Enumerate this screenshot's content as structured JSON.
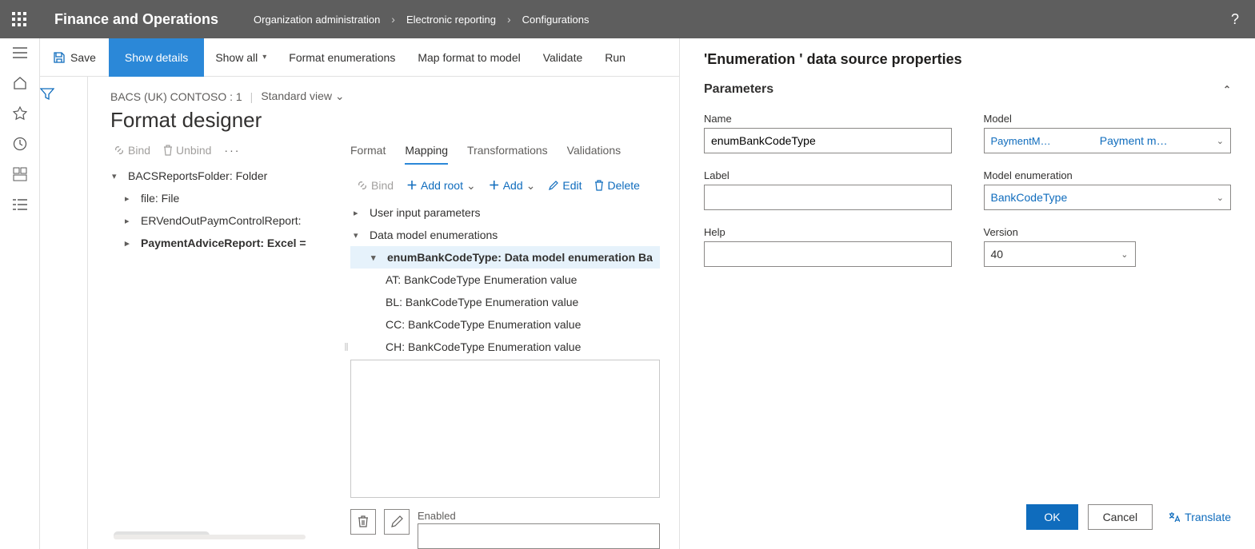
{
  "app_title": "Finance and Operations",
  "breadcrumb": [
    "Organization administration",
    "Electronic reporting",
    "Configurations"
  ],
  "cmdbar": {
    "save": "Save",
    "show_details": "Show details",
    "show_all": "Show all",
    "format_enum": "Format enumerations",
    "map_format": "Map format to model",
    "validate": "Validate",
    "run": "Run"
  },
  "designer": {
    "entity": "BACS (UK) CONTOSO : 1",
    "view": "Standard view",
    "title": "Format designer",
    "left_actions": {
      "bind": "Bind",
      "unbind": "Unbind"
    },
    "left_tree": [
      {
        "label": "BACSReportsFolder: Folder",
        "caret": "▾",
        "lvl": 0
      },
      {
        "label": "file: File",
        "caret": "▸",
        "lvl": 1
      },
      {
        "label": "ERVendOutPaymControlReport:",
        "caret": "▸",
        "lvl": 1
      },
      {
        "label": "PaymentAdviceReport: Excel =",
        "caret": "▸",
        "lvl": 1,
        "bold": true
      }
    ],
    "tabs": [
      "Format",
      "Mapping",
      "Transformations",
      "Validations"
    ],
    "active_tab": "Mapping",
    "right_actions": {
      "bind": "Bind",
      "add_root": "Add root",
      "add": "Add",
      "edit": "Edit",
      "delete": "Delete"
    },
    "map_tree": [
      {
        "label": "User input parameters",
        "caret": "▸",
        "lvl": 0
      },
      {
        "label": "Data model enumerations",
        "caret": "▾",
        "lvl": 0
      },
      {
        "label": "enumBankCodeType: Data model enumeration Ba",
        "caret": "▾",
        "lvl": 1,
        "sel": true
      },
      {
        "label": "AT: BankCodeType Enumeration value",
        "lvl": 2
      },
      {
        "label": "BL: BankCodeType Enumeration value",
        "lvl": 2
      },
      {
        "label": "CC: BankCodeType Enumeration value",
        "lvl": 2
      },
      {
        "label": "CH: BankCodeType Enumeration value",
        "lvl": 2
      }
    ],
    "enabled_label": "Enabled",
    "enabled_value": ""
  },
  "panel": {
    "title": "'Enumeration ' data source properties",
    "section": "Parameters",
    "fields": {
      "name_label": "Name",
      "name_value": "enumBankCodeType",
      "label_label": "Label",
      "label_value": "",
      "help_label": "Help",
      "help_value": "",
      "model_label": "Model",
      "model_value1": "PaymentM…",
      "model_value2": "Payment m…",
      "model_enum_label": "Model enumeration",
      "model_enum_value": "BankCodeType",
      "version_label": "Version",
      "version_value": "40"
    },
    "footer": {
      "ok": "OK",
      "cancel": "Cancel",
      "translate": "Translate"
    }
  }
}
